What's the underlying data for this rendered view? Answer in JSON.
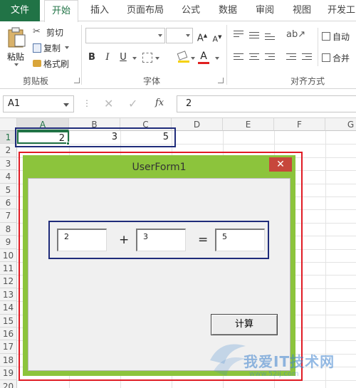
{
  "tabs": [
    "文件",
    "开始",
    "插入",
    "页面布局",
    "公式",
    "数据",
    "审阅",
    "视图",
    "开发工"
  ],
  "ribbon": {
    "clipboard": {
      "paste": "粘贴",
      "cut": "剪切",
      "copy": "复制",
      "format_painter": "格式刷",
      "label": "剪贴板"
    },
    "font": {
      "label": "字体",
      "bold": "B",
      "italic": "I",
      "underline": "U"
    },
    "alignment": {
      "label": "对齐方式",
      "wrap": "自动",
      "merge": "合并"
    }
  },
  "formula_bar": {
    "name_box": "A1",
    "fx": "fx",
    "value": "2"
  },
  "sheet": {
    "columns": [
      "A",
      "B",
      "C",
      "D",
      "E",
      "F",
      "G"
    ],
    "rows": [
      "1",
      "2",
      "3",
      "4",
      "5",
      "6",
      "7",
      "8",
      "9",
      "10",
      "11",
      "12",
      "13",
      "14",
      "15",
      "16",
      "17",
      "18",
      "19",
      "20"
    ],
    "cells": {
      "A1": "2",
      "B1": "3",
      "C1": "5"
    }
  },
  "userform": {
    "title": "UserForm1",
    "close": "✕",
    "textbox1": "2",
    "plus": "+",
    "textbox2": "3",
    "equals": "=",
    "textbox3": "5",
    "calc_button": "计算"
  },
  "watermark": {
    "text": "我爱IT技术网",
    "sub": "www.52ij.com"
  },
  "colors": {
    "accent": "#217346",
    "form_border": "#8cc43c",
    "close": "#c7473c",
    "highlight_red": "#e01b24",
    "highlight_blue": "#1f2c7a"
  }
}
